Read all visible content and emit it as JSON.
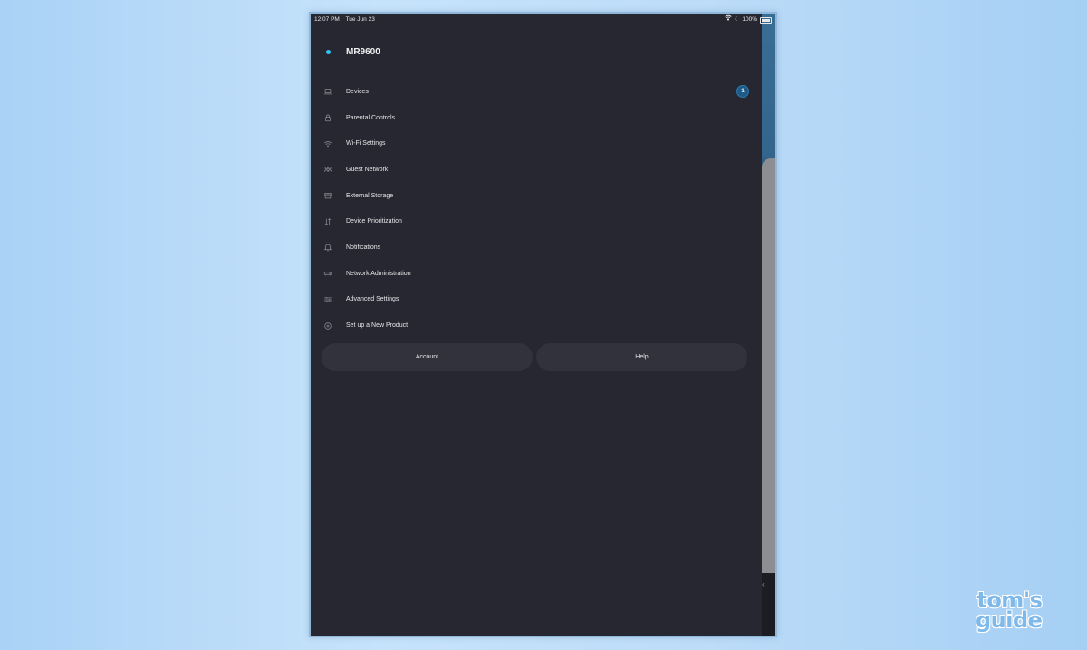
{
  "status_bar": {
    "time": "12:07 PM",
    "date": "Tue Jun 23",
    "battery_text": "100%"
  },
  "brand": {
    "title": "MR9600",
    "accent_color": "#2ec4ef"
  },
  "menu": {
    "items": [
      {
        "label": "Devices",
        "icon": "laptop-icon",
        "badge": "1"
      },
      {
        "label": "Parental Controls",
        "icon": "lock-icon"
      },
      {
        "label": "Wi-Fi Settings",
        "icon": "wifi-icon"
      },
      {
        "label": "Guest Network",
        "icon": "guest-icon"
      },
      {
        "label": "External Storage",
        "icon": "storage-icon"
      },
      {
        "label": "Device Prioritization",
        "icon": "priority-icon"
      },
      {
        "label": "Notifications",
        "icon": "bell-icon"
      },
      {
        "label": "Network Administration",
        "icon": "router-icon"
      },
      {
        "label": "Advanced Settings",
        "icon": "sliders-icon"
      },
      {
        "label": "Set up a New Product",
        "icon": "plus-circle-icon"
      }
    ]
  },
  "buttons": {
    "account_label": "Account",
    "help_label": "Help"
  },
  "watermark": {
    "line1": "tom's",
    "line2": "guide"
  }
}
